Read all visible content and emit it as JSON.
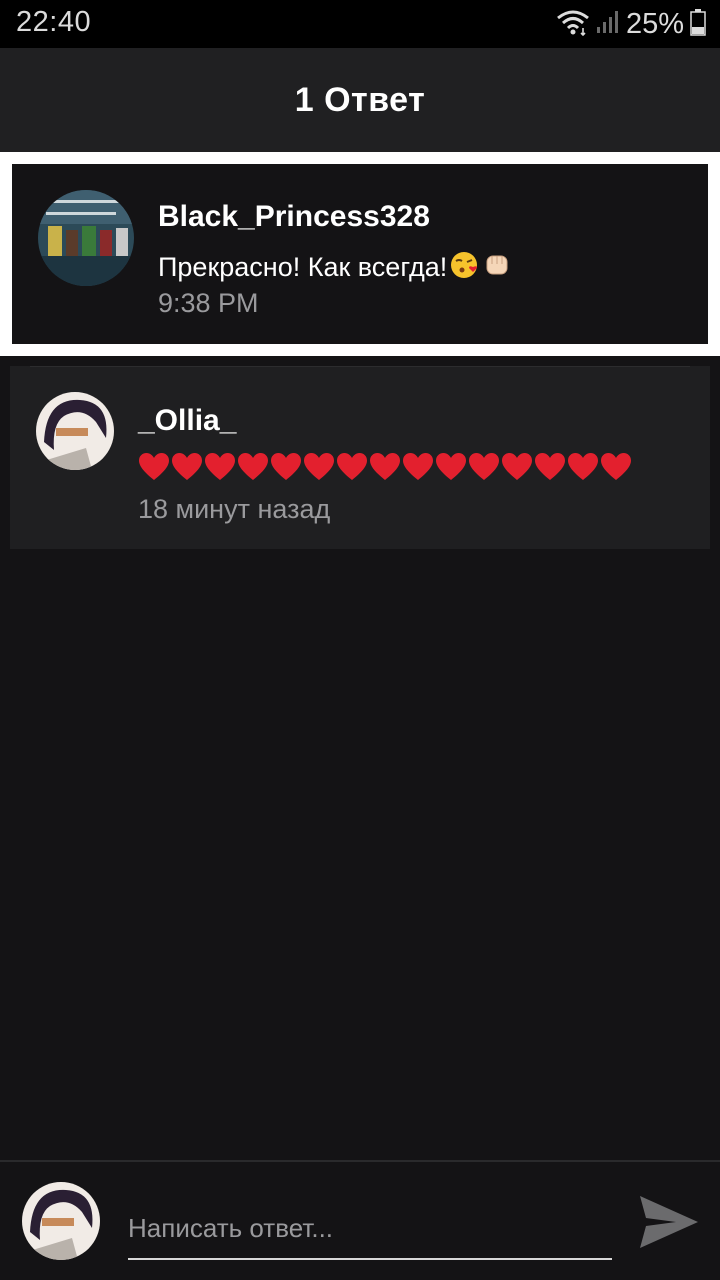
{
  "status_bar": {
    "time": "22:40",
    "battery_percent": "25%",
    "icons": [
      "wifi-icon",
      "signal-icon",
      "battery-icon"
    ]
  },
  "header": {
    "title": "1 Ответ"
  },
  "original_comment": {
    "author": "Black_Princess328",
    "text": "Прекрасно! Как всегда!",
    "emoji_icons": [
      "kissing-face-icon",
      "raised-fist-icon"
    ],
    "time": "9:38 PM"
  },
  "reply": {
    "author": "_Ollia_",
    "heart_count": 15,
    "time": "18 минут назад"
  },
  "composer": {
    "placeholder": "Написать ответ...",
    "send_icon": "send-icon"
  },
  "colors": {
    "background": "#141315",
    "header": "#202022",
    "card": "#1f1f21",
    "muted_text": "#9a9a9d",
    "heart": "#e3202e"
  }
}
